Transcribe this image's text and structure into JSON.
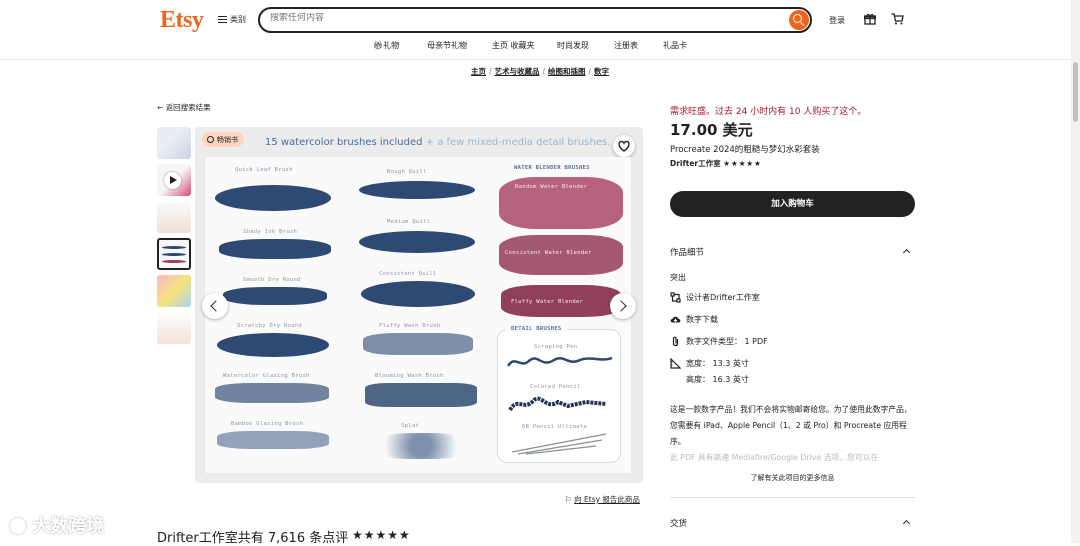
{
  "header": {
    "logo": "Etsy",
    "categories_label": "类别",
    "search_placeholder": "搜索任何内容",
    "login_label": "登录"
  },
  "nav": {
    "items": [
      "礼物",
      "母亲节礼物",
      "主页 收藏夹",
      "时尚发现",
      "注册表",
      "礼品卡"
    ]
  },
  "breadcrumb": {
    "items": [
      "主页",
      "艺术与收藏品",
      "绘图和插图",
      "数字"
    ]
  },
  "back_link": "返回搜索结果",
  "image": {
    "badge": "畅销书",
    "headline_main": "15 watercolor brushes included",
    "headline_sub": " + a few mixed-media detail brushes.",
    "labels": {
      "b1": "Quick Leaf Brush",
      "b2": "Rough Quill",
      "b3": "WATER BLENDER BRUSHES",
      "b4": "Random Water Blender",
      "b5": "Shady Ink Brush",
      "b6": "Medium Quill",
      "b7": "Consistent Water Blender",
      "b8": "Smooth Dry Round",
      "b9": "Consistent Quill",
      "b10": "Fluffy Water Blender",
      "b11": "Scratchy Dry Round",
      "b12": "Fluffy Wash Brush",
      "b13": "DETAIL BRUSHES",
      "b14": "Scraping Pen",
      "b15": "Watercolor Glazing Brush",
      "b16": "Blooming Wash Brush",
      "b17": "Colored Pencil",
      "b18": "Bamboo Glazing Brush",
      "b19": "Splat",
      "b20": "6B Pencil Ultimate"
    }
  },
  "report": "向 Etsy 报告此商品",
  "reviews": {
    "title": "Drifter工作室共有 7,616 条点评",
    "stars": "★★★★★"
  },
  "watermark": "大数跨境",
  "product": {
    "demand": "需求旺盛。过去 24 小时内有 10 人购买了这个。",
    "price": "17.00 美元",
    "title": "Procreate 2024的粗糙与梦幻水彩套装",
    "shop": "Drifter工作室",
    "shop_stars": "★★★★★",
    "add_to_cart": "加入购物车",
    "details_header": "作品细节",
    "highlights_label": "突出",
    "designer": "设计者Drifter工作室",
    "digital": "数字下载",
    "file_type": "数字文件类型： 1 PDF",
    "width": "宽度： 13.3 英寸",
    "height": "高度： 16.3 英寸",
    "description": "这是一款数字产品！我们不会将实物邮寄给您。为了使用此数字产品，您需要有 iPad、Apple Pencil（1、2 或 Pro）和 Procreate 应用程序。",
    "description_fade": "此 PDF 具有高速 Mediafire/Google Drive 选项，您可以在",
    "more": "了解有关此项目的更多信息",
    "delivery_header": "交货"
  },
  "colors": {
    "accent": "#f1641e",
    "demand": "#a61a2e",
    "ink": "#2e4a72",
    "blender": "#9c3a5a"
  }
}
